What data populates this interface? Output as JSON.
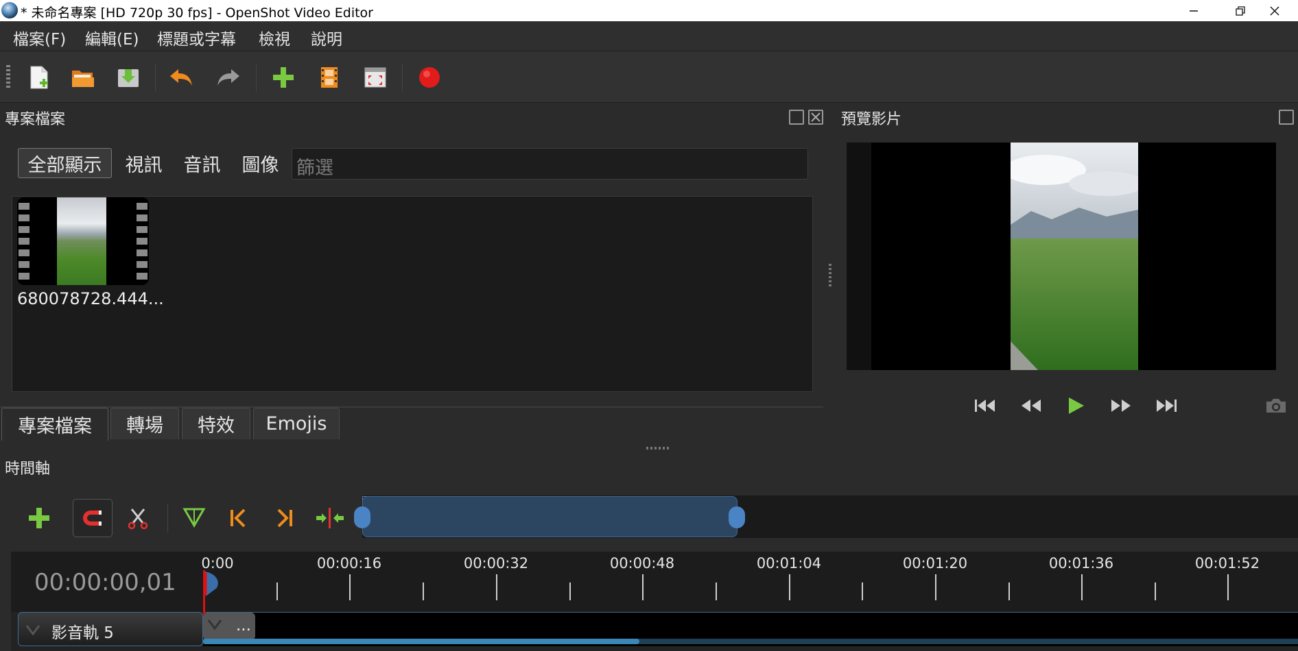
{
  "window": {
    "title": "* 未命名專案 [HD 720p 30 fps] - OpenShot Video Editor"
  },
  "menu": {
    "items": [
      "檔案(F)",
      "編輯(E)",
      "標題或字幕",
      "檢視",
      "說明"
    ]
  },
  "toolbar": {
    "buttons": [
      "new-project-icon",
      "open-project-icon",
      "save-project-icon",
      "undo-icon",
      "redo-icon",
      "import-files-icon",
      "profile-icon",
      "fullscreen-icon",
      "export-icon"
    ]
  },
  "project_files": {
    "title": "專案檔案",
    "filters": [
      "全部顯示",
      "視訊",
      "音訊",
      "圖像"
    ],
    "filter_placeholder": "篩選",
    "files": [
      {
        "name": "680078728.444..."
      }
    ]
  },
  "bottom_tabs": [
    "專案檔案",
    "轉場",
    "特效",
    "Emojis"
  ],
  "preview": {
    "title": "預覽影片",
    "controls": [
      "jump-start-icon",
      "rewind-icon",
      "play-icon",
      "fast-forward-icon",
      "jump-end-icon",
      "camera-icon"
    ]
  },
  "timeline": {
    "title": "時間軸",
    "timecode": "00:00:00,01",
    "ticks": [
      "0:00",
      "00:00:16",
      "00:00:32",
      "00:00:48",
      "00:01:04",
      "00:01:20",
      "00:01:36",
      "00:01:52"
    ],
    "tracks": [
      {
        "name": "影音軌 5",
        "clip_label": "..."
      }
    ]
  },
  "colors": {
    "accent": "#3a87b5",
    "playhead": "#e01010",
    "background": "#2b2b2b"
  }
}
